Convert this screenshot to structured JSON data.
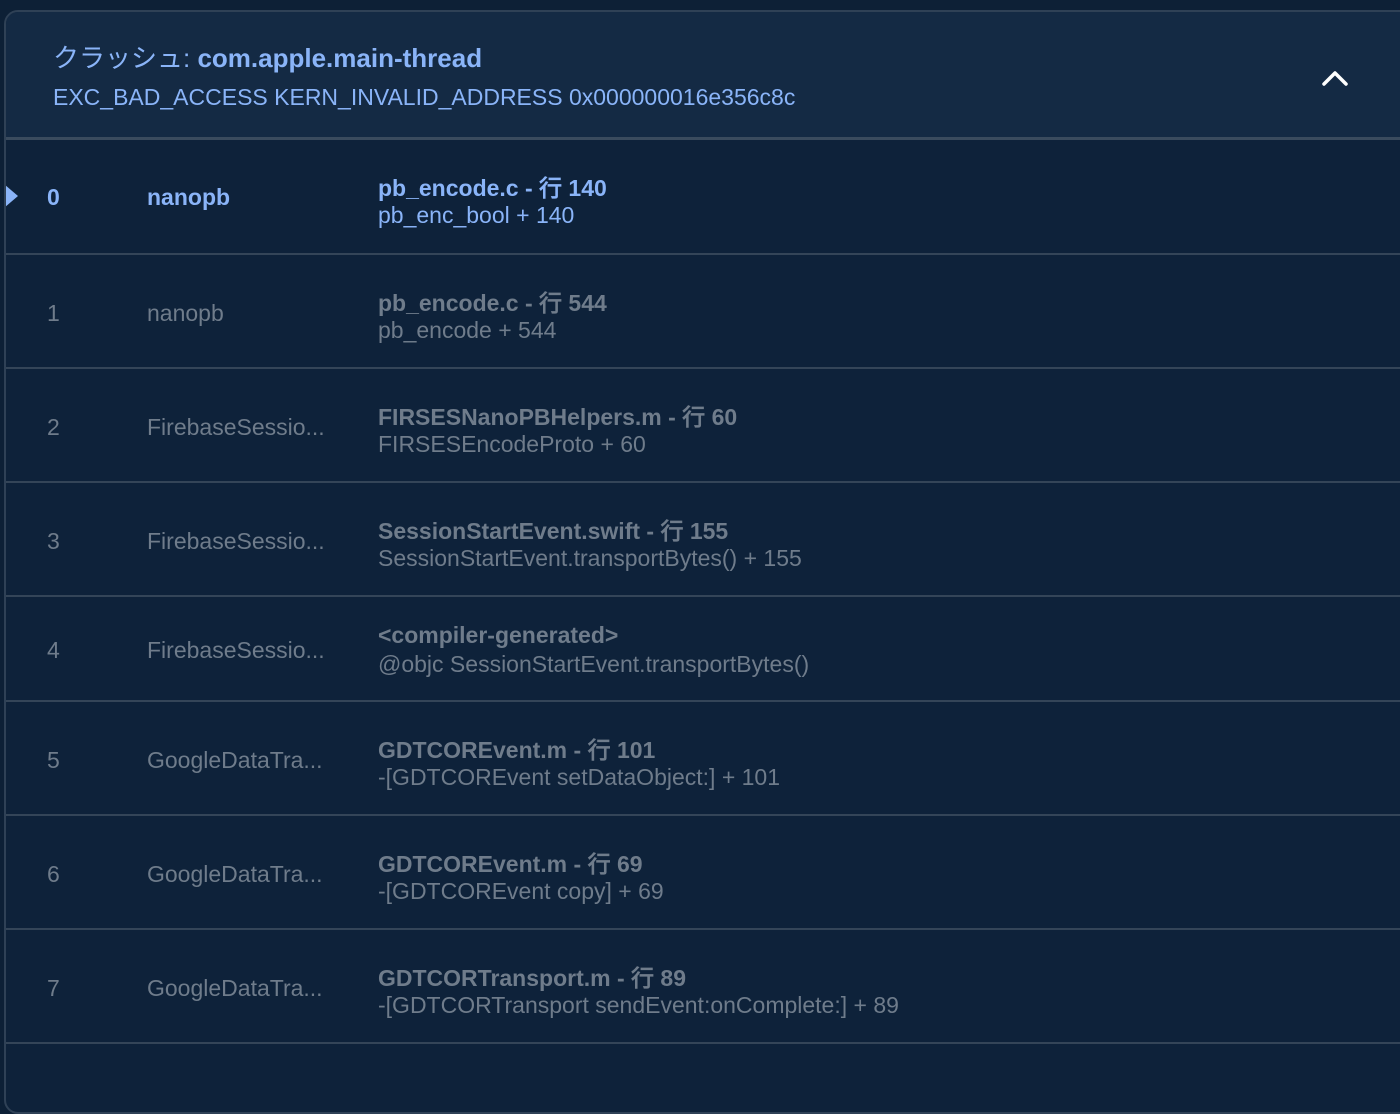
{
  "header": {
    "crash_label": "クラッシュ: ",
    "thread_name": "com.apple.main-thread",
    "exception": "EXC_BAD_ACCESS KERN_INVALID_ADDRESS 0x000000016e356c8c",
    "collapse_icon": "chevron-up-icon"
  },
  "colors": {
    "accent": "#8ab4f8",
    "muted_text": "#6f7c8b",
    "background": "#0e223a",
    "header_background": "#142a44"
  },
  "frames": [
    {
      "index": "0",
      "library": "nanopb",
      "location": "pb_encode.c - 行 140",
      "symbol": "pb_enc_bool + 140"
    },
    {
      "index": "1",
      "library": "nanopb",
      "location": "pb_encode.c - 行 544",
      "symbol": "pb_encode + 544"
    },
    {
      "index": "2",
      "library": "FirebaseSessio...",
      "location": "FIRSESNanoPBHelpers.m - 行 60",
      "symbol": "FIRSESEncodeProto + 60"
    },
    {
      "index": "3",
      "library": "FirebaseSessio...",
      "location": "SessionStartEvent.swift - 行 155",
      "symbol": "SessionStartEvent.transportBytes() + 155"
    },
    {
      "index": "4",
      "library": "FirebaseSessio...",
      "location": "<compiler-generated>",
      "symbol": "@objc SessionStartEvent.transportBytes()"
    },
    {
      "index": "5",
      "library": "GoogleDataTra...",
      "location": "GDTCOREvent.m - 行 101",
      "symbol": "-[GDTCOREvent setDataObject:] + 101"
    },
    {
      "index": "6",
      "library": "GoogleDataTra...",
      "location": "GDTCOREvent.m - 行 69",
      "symbol": "-[GDTCOREvent copy] + 69"
    },
    {
      "index": "7",
      "library": "GoogleDataTra...",
      "location": "GDTCORTransport.m - 行 89",
      "symbol": "-[GDTCORTransport sendEvent:onComplete:] + 89"
    }
  ]
}
